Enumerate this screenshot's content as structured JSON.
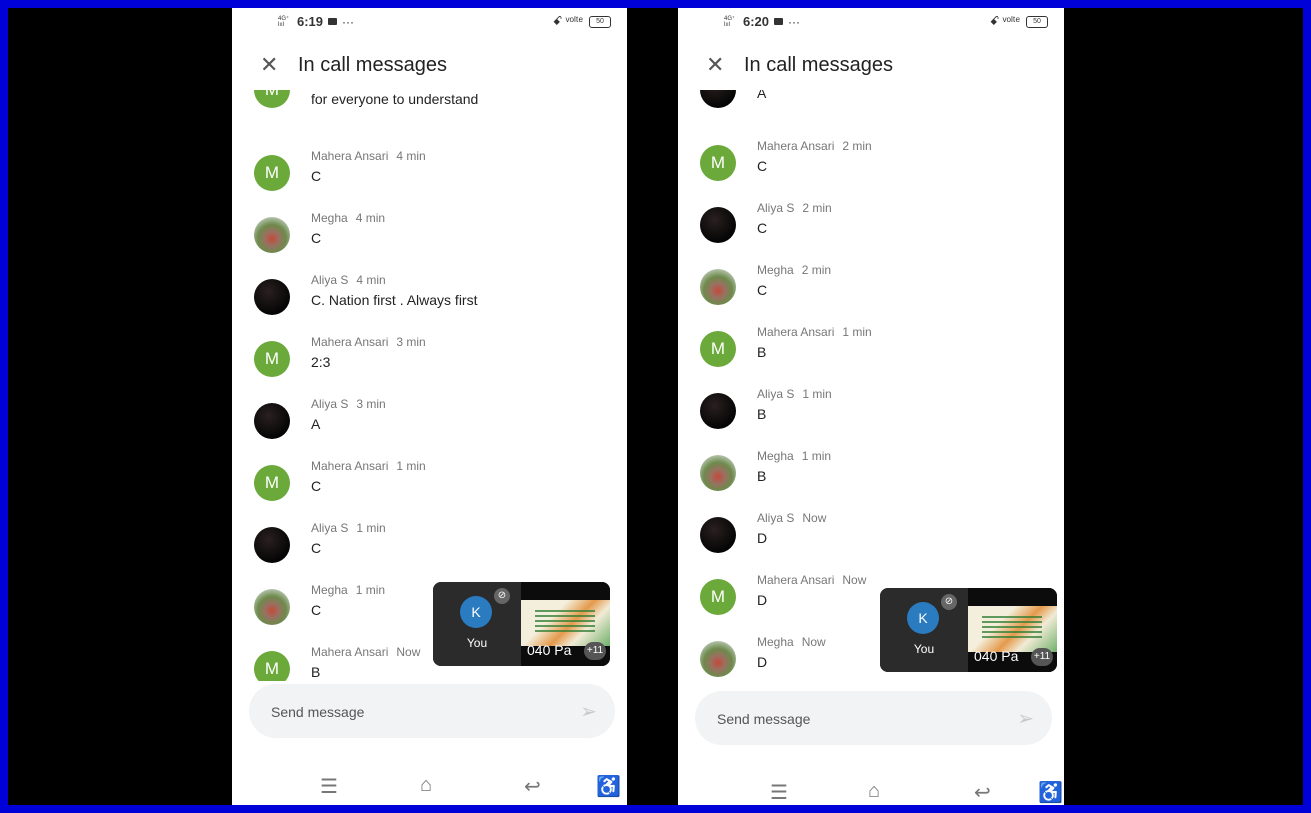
{
  "screens": [
    {
      "status": {
        "signal": "4G⁺ Ɩııl",
        "time": "6:19",
        "more": "···",
        "right_icons": "ꗃ ᵛᵒˡᵗᵉ",
        "battery": "50"
      },
      "header": {
        "title": "In call messages"
      },
      "messages": [
        {
          "sender": "",
          "ago": "",
          "text": "If u could switch on the subs ..it would be easy for everyone to understand",
          "avatar": "M",
          "avatar_type": "letter"
        },
        {
          "sender": "Mahera Ansari",
          "ago": "4 min",
          "text": "C",
          "avatar": "M",
          "avatar_type": "letter"
        },
        {
          "sender": "Megha",
          "ago": "4 min",
          "text": "C",
          "avatar": "",
          "avatar_type": "photo"
        },
        {
          "sender": "Aliya S",
          "ago": "4 min",
          "text": "C. Nation first . Always first",
          "avatar": "",
          "avatar_type": "dark"
        },
        {
          "sender": "Mahera Ansari",
          "ago": "3 min",
          "text": "2:3",
          "avatar": "M",
          "avatar_type": "letter"
        },
        {
          "sender": "Aliya S",
          "ago": "3 min",
          "text": "A",
          "avatar": "",
          "avatar_type": "dark"
        },
        {
          "sender": "Mahera Ansari",
          "ago": "1 min",
          "text": "C",
          "avatar": "M",
          "avatar_type": "letter"
        },
        {
          "sender": "Aliya S",
          "ago": "1 min",
          "text": "C",
          "avatar": "",
          "avatar_type": "dark"
        },
        {
          "sender": "Megha",
          "ago": "1 min",
          "text": "C",
          "avatar": "",
          "avatar_type": "photo"
        },
        {
          "sender": "Mahera Ansari",
          "ago": "Now",
          "text": "B",
          "avatar": "M",
          "avatar_type": "letter"
        }
      ],
      "pip": {
        "avatar": "K",
        "you_label": "You",
        "caption": "040 Pa",
        "count": "+11",
        "mic_icon": "mic-off-icon"
      },
      "composer": {
        "placeholder": "Send message",
        "send_icon": "send-icon"
      },
      "nav": {
        "menu": "☰",
        "home": "⌂",
        "back": "↩",
        "accessibility": "♿"
      }
    },
    {
      "status": {
        "signal": "4G⁺ Ɩııl",
        "time": "6:20",
        "more": "···",
        "right_icons": "ꗃ ᵛᵒˡᵗᵉ",
        "battery": "50"
      },
      "header": {
        "title": "In call messages"
      },
      "messages": [
        {
          "sender": "",
          "ago": "",
          "text": "A",
          "avatar": "",
          "avatar_type": "dark"
        },
        {
          "sender": "Mahera Ansari",
          "ago": "2 min",
          "text": "C",
          "avatar": "M",
          "avatar_type": "letter"
        },
        {
          "sender": "Aliya S",
          "ago": "2 min",
          "text": "C",
          "avatar": "",
          "avatar_type": "dark"
        },
        {
          "sender": "Megha",
          "ago": "2 min",
          "text": "C",
          "avatar": "",
          "avatar_type": "photo"
        },
        {
          "sender": "Mahera Ansari",
          "ago": "1 min",
          "text": "B",
          "avatar": "M",
          "avatar_type": "letter"
        },
        {
          "sender": "Aliya S",
          "ago": "1 min",
          "text": "B",
          "avatar": "",
          "avatar_type": "dark"
        },
        {
          "sender": "Megha",
          "ago": "1 min",
          "text": "B",
          "avatar": "",
          "avatar_type": "photo"
        },
        {
          "sender": "Aliya S",
          "ago": "Now",
          "text": "D",
          "avatar": "",
          "avatar_type": "dark"
        },
        {
          "sender": "Mahera Ansari",
          "ago": "Now",
          "text": "D",
          "avatar": "M",
          "avatar_type": "letter"
        },
        {
          "sender": "Megha",
          "ago": "Now",
          "text": "D",
          "avatar": "",
          "avatar_type": "photo"
        }
      ],
      "pip": {
        "avatar": "K",
        "you_label": "You",
        "caption": "040 Pa",
        "count": "+11",
        "mic_icon": "mic-off-icon"
      },
      "composer": {
        "placeholder": "Send message",
        "send_icon": "send-icon"
      },
      "nav": {
        "menu": "☰",
        "home": "⌂",
        "back": "↩",
        "accessibility": "♿"
      }
    }
  ]
}
